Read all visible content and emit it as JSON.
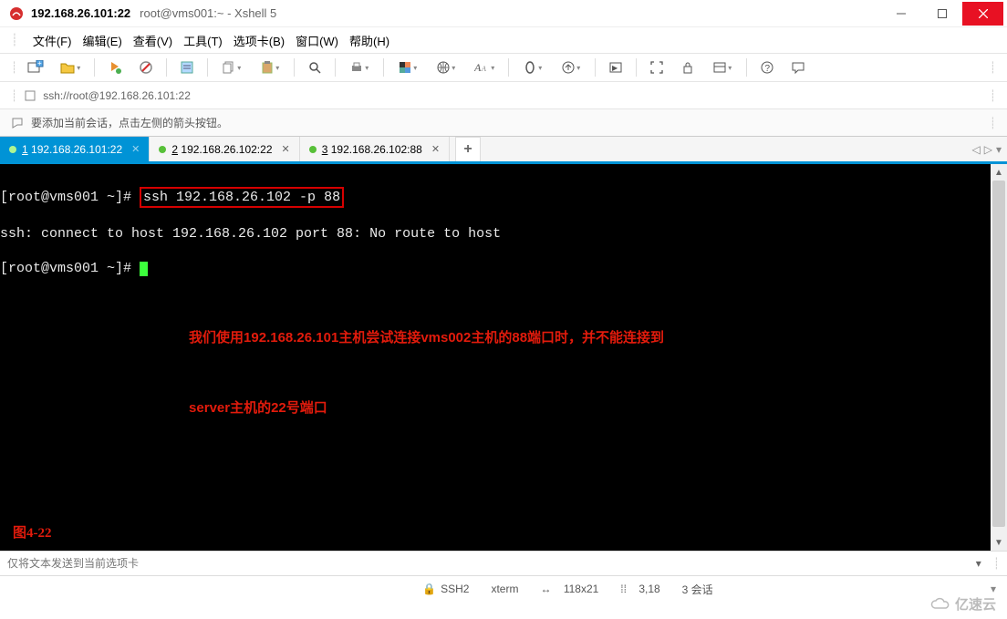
{
  "title_bar": {
    "host": "192.168.26.101:22",
    "rest": "root@vms001:~ - Xshell 5"
  },
  "menu": {
    "items": [
      "文件(F)",
      "编辑(E)",
      "查看(V)",
      "工具(T)",
      "选项卡(B)",
      "窗口(W)",
      "帮助(H)"
    ]
  },
  "address": {
    "url": "ssh://root@192.168.26.101:22"
  },
  "info_bar": {
    "text": "要添加当前会话，点击左侧的箭头按钮。"
  },
  "tabs": {
    "items": [
      {
        "num": "1",
        "label": "192.168.26.101:22",
        "active": true
      },
      {
        "num": "2",
        "label": "192.168.26.102:22",
        "active": false
      },
      {
        "num": "3",
        "label": "192.168.26.102:88",
        "active": false
      }
    ],
    "add": "+"
  },
  "terminal": {
    "prompt1_a": "[root@vms001 ~]# ",
    "prompt1_cmd": "ssh 192.168.26.102 -p 88",
    "line2": "ssh: connect to host 192.168.26.102 port 88: No route to host",
    "prompt2": "[root@vms001 ~]# ",
    "note_l1": "我们使用192.168.26.101主机尝试连接vms002主机的88端口时，并不能连接到",
    "note_l2": "server主机的22号端口",
    "figure": "图4-22"
  },
  "input_bar": {
    "placeholder": "仅将文本发送到当前选项卡"
  },
  "status": {
    "ssh": "SSH2",
    "term": "xterm",
    "size": "118x21",
    "pos": "3,18",
    "sessions": "3 会话"
  },
  "watermark": "亿速云"
}
